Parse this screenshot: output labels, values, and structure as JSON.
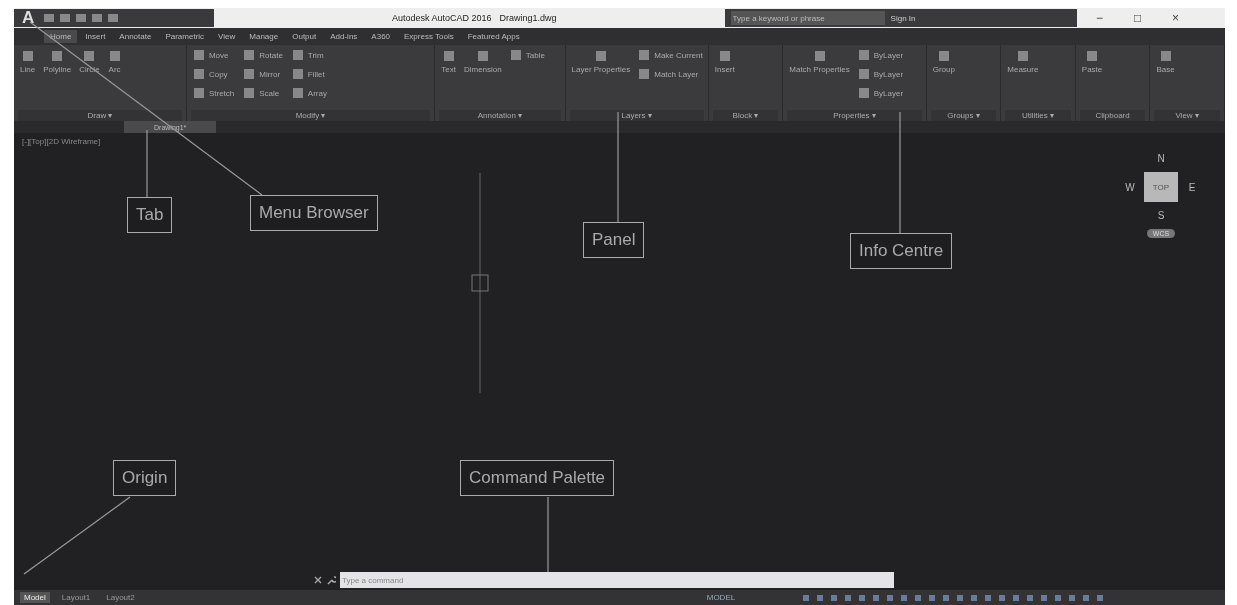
{
  "title_bar": {
    "app_title": "Autodesk AutoCAD 2016",
    "file_name": "Drawing1.dwg",
    "search": {
      "placeholder": "Type a keyword or phrase"
    },
    "sign_in": "Sign In",
    "window_controls": [
      "−",
      "□",
      "×"
    ]
  },
  "menu_browser": {
    "label": "A"
  },
  "ribbon_tabs": [
    {
      "label": "Home",
      "selected": true
    },
    {
      "label": "Insert",
      "selected": false
    },
    {
      "label": "Annotate",
      "selected": false
    },
    {
      "label": "Parametric",
      "selected": false
    },
    {
      "label": "View",
      "selected": false
    },
    {
      "label": "Manage",
      "selected": false
    },
    {
      "label": "Output",
      "selected": false
    },
    {
      "label": "Add-ins",
      "selected": false
    },
    {
      "label": "A360",
      "selected": false
    },
    {
      "label": "Express Tools",
      "selected": false
    },
    {
      "label": "Featured Apps",
      "selected": false
    }
  ],
  "ribbon_panels": [
    {
      "title": "Draw ▾",
      "big": [
        "Line",
        "Polyline",
        "Circle",
        "Arc"
      ]
    },
    {
      "title": "Modify ▾",
      "small": [
        "Move",
        "Rotate",
        "Trim",
        "Copy",
        "Mirror",
        "Fillet",
        "Stretch",
        "Scale",
        "Array"
      ]
    },
    {
      "title": "Annotation ▾",
      "big": [
        "Text",
        "Dimension"
      ],
      "small": [
        "Table"
      ]
    },
    {
      "title": "Layers ▾",
      "big": [
        "Layer Properties"
      ],
      "small": [
        "Make Current",
        "Match Layer"
      ]
    },
    {
      "title": "Block ▾",
      "big": [
        "Insert"
      ]
    },
    {
      "title": "Properties ▾",
      "big": [
        "Match Properties"
      ],
      "small": [
        "ByLayer",
        "ByLayer",
        "ByLayer"
      ]
    },
    {
      "title": "Groups ▾",
      "big": [
        "Group"
      ]
    },
    {
      "title": "Utilities ▾",
      "big": [
        "Measure"
      ]
    },
    {
      "title": "Clipboard",
      "big": [
        "Paste"
      ]
    },
    {
      "title": "View ▾",
      "big": [
        "Base"
      ]
    }
  ],
  "file_tabs": [
    {
      "label": "Drawing1*",
      "selected": true
    }
  ],
  "viewport": {
    "label": "[-][Top][2D Wireframe]",
    "viewcube": {
      "north": "N",
      "west": "W",
      "top": "TOP",
      "east": "E",
      "south": "S",
      "wcs": "WCS"
    }
  },
  "annotations": [
    {
      "label": "Tab"
    },
    {
      "label": "Menu Browser"
    },
    {
      "label": "Panel"
    },
    {
      "label": "Info Centre"
    },
    {
      "label": "Origin"
    },
    {
      "label": "Command Palette"
    }
  ],
  "command_line": {
    "placeholder": "Type a command"
  },
  "layout_tabs": [
    {
      "label": "Model",
      "selected": true
    },
    {
      "label": "Layout1",
      "selected": false
    },
    {
      "label": "Layout2",
      "selected": false
    }
  ],
  "status_bar": {
    "mode": "MODEL"
  }
}
